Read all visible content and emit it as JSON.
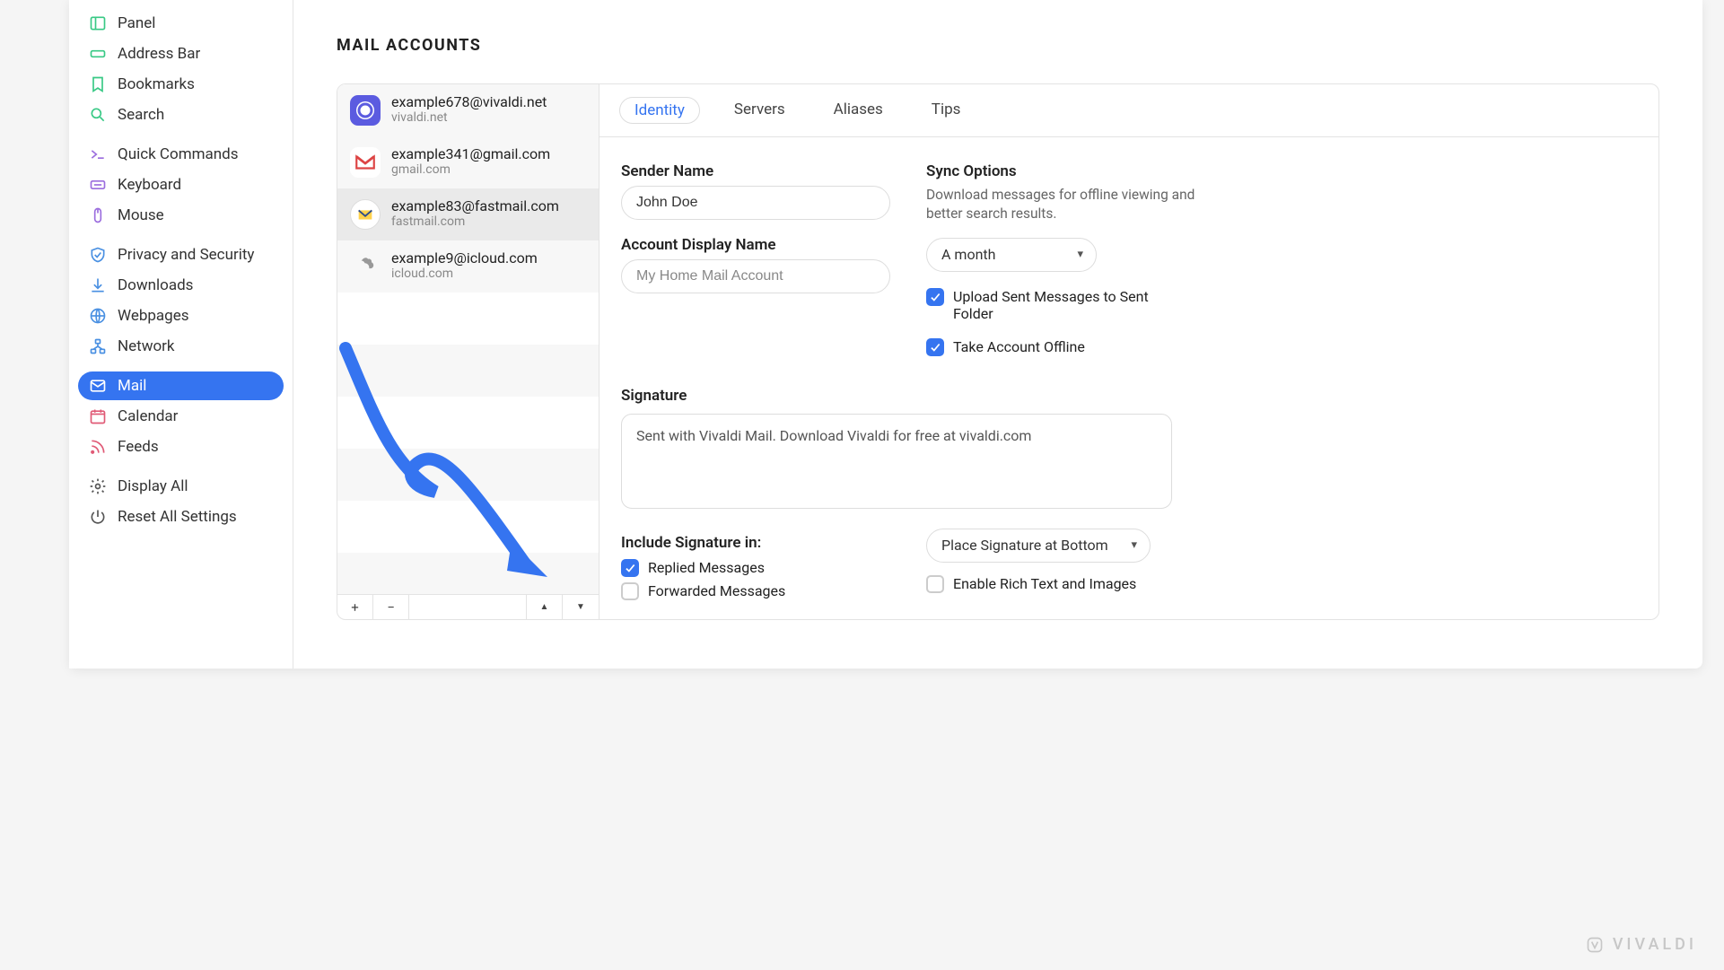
{
  "section_title": "MAIL ACCOUNTS",
  "sidebar": {
    "groups": [
      [
        {
          "label": "Panel",
          "icon": "panel",
          "color": "#38c985"
        },
        {
          "label": "Address Bar",
          "icon": "addressbar",
          "color": "#38c985"
        },
        {
          "label": "Bookmarks",
          "icon": "bookmark",
          "color": "#38c985"
        },
        {
          "label": "Search",
          "icon": "search",
          "color": "#38c985"
        }
      ],
      [
        {
          "label": "Quick Commands",
          "icon": "quick",
          "color": "#9b6dde"
        },
        {
          "label": "Keyboard",
          "icon": "keyboard",
          "color": "#9b6dde"
        },
        {
          "label": "Mouse",
          "icon": "mouse",
          "color": "#9b6dde"
        }
      ],
      [
        {
          "label": "Privacy and Security",
          "icon": "shield",
          "color": "#4a90e2"
        },
        {
          "label": "Downloads",
          "icon": "download",
          "color": "#4a90e2"
        },
        {
          "label": "Webpages",
          "icon": "globe",
          "color": "#4a90e2"
        },
        {
          "label": "Network",
          "icon": "network",
          "color": "#4a90e2"
        }
      ],
      [
        {
          "label": "Mail",
          "icon": "mail",
          "color": "#fff",
          "active": true
        },
        {
          "label": "Calendar",
          "icon": "calendar",
          "color": "#e05a76"
        },
        {
          "label": "Feeds",
          "icon": "rss",
          "color": "#e05a76"
        }
      ],
      [
        {
          "label": "Display All",
          "icon": "gear",
          "color": "#555"
        },
        {
          "label": "Reset All Settings",
          "icon": "power",
          "color": "#555"
        }
      ]
    ]
  },
  "accounts": [
    {
      "email": "example678@vivaldi.net",
      "domain": "vivaldi.net",
      "iconBg": "#5b5be0",
      "iconText": "V",
      "stripe": true
    },
    {
      "email": "example341@gmail.com",
      "domain": "gmail.com",
      "iconBg": "#fff",
      "iconText": "M"
    },
    {
      "email": "example83@fastmail.com",
      "domain": "fastmail.com",
      "iconBg": "#fff",
      "iconText": "◶",
      "selected": true,
      "stripe": true
    },
    {
      "email": "example9@icloud.com",
      "domain": "icloud.com",
      "iconBg": "transparent",
      "iconText": ""
    }
  ],
  "toolbar": {
    "add": "+",
    "remove": "−",
    "up": "▲",
    "down": "▼"
  },
  "tabs": [
    {
      "label": "Identity",
      "active": true
    },
    {
      "label": "Servers"
    },
    {
      "label": "Aliases"
    },
    {
      "label": "Tips"
    }
  ],
  "identity": {
    "sender_name_label": "Sender Name",
    "sender_name_value": "John Doe",
    "display_name_label": "Account Display Name",
    "display_name_placeholder": "My Home Mail Account",
    "sync_label": "Sync Options",
    "sync_desc": "Download messages for offline viewing and better search results.",
    "sync_range": "A month",
    "upload_sent": "Upload Sent Messages to Sent Folder",
    "take_offline": "Take Account Offline",
    "sig_label": "Signature",
    "sig_value": "Sent with Vivaldi Mail. Download Vivaldi for free at vivaldi.com",
    "include_label": "Include Signature in:",
    "replied": "Replied Messages",
    "forwarded": "Forwarded Messages",
    "place_sig": "Place Signature at Bottom",
    "rich_text": "Enable Rich Text and Images"
  },
  "watermark": "VIVALDI"
}
